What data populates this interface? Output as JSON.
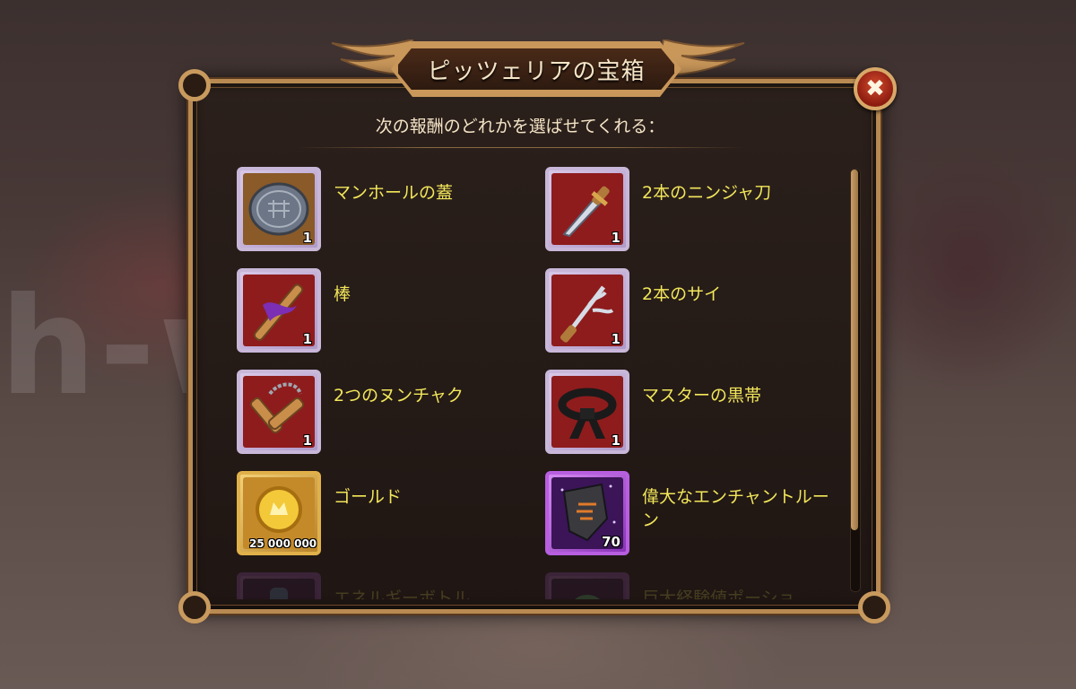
{
  "watermark": "h-w-fun",
  "dialog": {
    "title": "ピッツェリアの宝箱",
    "subtitle": "次の報酬のどれかを選ばせてくれる：",
    "close_icon": "✖"
  },
  "rewards": [
    {
      "name": "マンホールの蓋",
      "quantity": "1",
      "icon": "manhole-cover-icon",
      "rarity": "pink"
    },
    {
      "name": "2本のニンジャ刀",
      "quantity": "1",
      "icon": "ninja-sword-icon",
      "rarity": "pink"
    },
    {
      "name": "棒",
      "quantity": "1",
      "icon": "bo-staff-icon",
      "rarity": "pink"
    },
    {
      "name": "2本のサイ",
      "quantity": "1",
      "icon": "sai-icon",
      "rarity": "pink"
    },
    {
      "name": "2つのヌンチャク",
      "quantity": "1",
      "icon": "nunchaku-icon",
      "rarity": "pink"
    },
    {
      "name": "マスターの黒帯",
      "quantity": "1",
      "icon": "black-belt-icon",
      "rarity": "pink"
    },
    {
      "name": "ゴールド",
      "quantity": "25 000 000",
      "icon": "gold-coin-icon",
      "rarity": "gold"
    },
    {
      "name": "偉大なエンチャントルーン",
      "quantity": "70",
      "icon": "enchant-rune-icon",
      "rarity": "epic"
    },
    {
      "name": "エネルギーボトル",
      "quantity": "",
      "icon": "energy-bottle-icon",
      "rarity": "epic"
    },
    {
      "name": "巨大経験値ポーショ",
      "quantity": "",
      "icon": "xp-potion-icon",
      "rarity": "epic"
    }
  ],
  "colors": {
    "frame_gold": "#b88a52",
    "item_name": "#f2e65a",
    "title_text": "#f6e6c8"
  }
}
